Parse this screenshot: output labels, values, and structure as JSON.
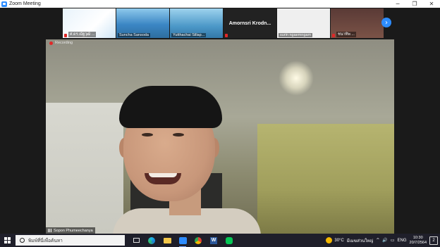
{
  "window": {
    "title": "Zoom Meeting",
    "controls": {
      "minimize": "─",
      "maximize": "❐",
      "close": "✕"
    }
  },
  "thumbnails": [
    {
      "name": "ศ.ดร.ณัฐวุฒิ ...",
      "kind": "video"
    },
    {
      "name": "Suncha Sansoda",
      "kind": "video"
    },
    {
      "name": "Yutthachai Sillap...",
      "kind": "video"
    },
    {
      "name": "Amornsri Krodn...",
      "kind": "name-only"
    },
    {
      "name": "surin ngaemngam",
      "kind": "video"
    },
    {
      "name": "ชนาทิพ ...",
      "kind": "video"
    }
  ],
  "next_button": "›",
  "recording": {
    "label": "Recording"
  },
  "main_video": {
    "speaker": "Sopon Phumeechanya"
  },
  "taskbar": {
    "search_placeholder": "พิมพ์ที่นี่เพื่อค้นหา",
    "word_letter": "W",
    "weather": {
      "temp": "30°C",
      "condition": "มีเมฆส่วนใหญ่"
    },
    "language": "ENG",
    "time": "10:30",
    "date": "20/7/2564",
    "notification_count": "2",
    "tray_chevron": "^",
    "tray_volume": "🔊",
    "tray_network": "▭"
  },
  "colors": {
    "zoom_blue": "#2d8cff",
    "recording_red": "#e02828",
    "taskbar": "#1f1f2a"
  }
}
